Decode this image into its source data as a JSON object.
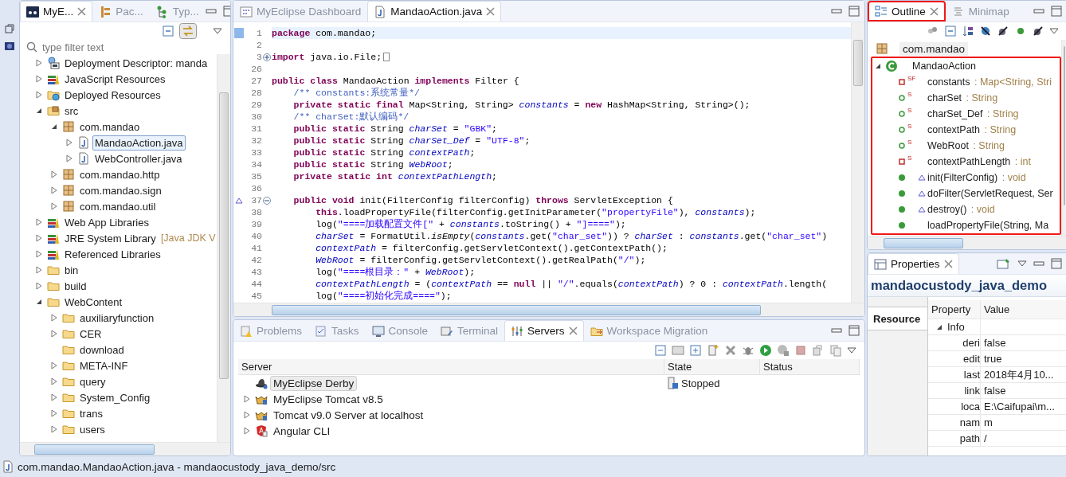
{
  "left_panel": {
    "tabs": [
      {
        "label": "MyE...",
        "selected": true,
        "kind": "explorer"
      },
      {
        "label": "Pac...",
        "selected": false,
        "kind": "packages"
      },
      {
        "label": "Typ...",
        "selected": false,
        "kind": "hierarchy"
      }
    ],
    "filter": {
      "placeholder": "type filter text"
    },
    "tree": [
      {
        "label": "Deployment Descriptor: manda",
        "kind": "descriptor",
        "expanded": false,
        "selected": false
      },
      {
        "label": "JavaScript Resources",
        "kind": "library",
        "expanded": false,
        "selected": false
      },
      {
        "label": "Deployed Resources",
        "kind": "deployed",
        "expanded": false,
        "selected": false
      },
      {
        "label": "src",
        "kind": "source-folder",
        "expanded": true,
        "selected": false,
        "children": [
          {
            "label": "com.mandao",
            "kind": "package",
            "expanded": true,
            "selected": false,
            "children": [
              {
                "label": "MandaoAction.java",
                "kind": "java",
                "expanded": false,
                "selected": true
              },
              {
                "label": "WebController.java",
                "kind": "java",
                "expanded": false,
                "selected": false
              }
            ]
          },
          {
            "label": "com.mandao.http",
            "kind": "package",
            "expanded": false,
            "selected": false
          },
          {
            "label": "com.mandao.sign",
            "kind": "package",
            "expanded": false,
            "selected": false
          },
          {
            "label": "com.mandao.util",
            "kind": "package",
            "expanded": false,
            "selected": false
          }
        ]
      },
      {
        "label": "Web App Libraries",
        "kind": "library",
        "expanded": false,
        "selected": false
      },
      {
        "label": "JRE System Library",
        "decoration": "[Java JDK V",
        "kind": "library",
        "expanded": false,
        "selected": false
      },
      {
        "label": "Referenced Libraries",
        "kind": "library",
        "expanded": false,
        "selected": false
      },
      {
        "label": "bin",
        "kind": "folder",
        "expanded": false,
        "selected": false
      },
      {
        "label": "build",
        "kind": "folder",
        "expanded": false,
        "selected": false
      },
      {
        "label": "WebContent",
        "kind": "folder",
        "expanded": true,
        "selected": false,
        "children": [
          {
            "label": "auxiliaryfunction",
            "kind": "folder",
            "expanded": false,
            "selected": false
          },
          {
            "label": "CER",
            "kind": "folder",
            "expanded": false,
            "selected": false
          },
          {
            "label": "download",
            "kind": "folder",
            "selected": false
          },
          {
            "label": "META-INF",
            "kind": "folder",
            "expanded": false,
            "selected": false
          },
          {
            "label": "query",
            "kind": "folder",
            "expanded": false,
            "selected": false
          },
          {
            "label": "System_Config",
            "kind": "folder",
            "expanded": false,
            "selected": false
          },
          {
            "label": "trans",
            "kind": "folder",
            "expanded": false,
            "selected": false
          },
          {
            "label": "users",
            "kind": "folder",
            "expanded": false,
            "selected": false
          }
        ]
      }
    ]
  },
  "editor": {
    "tabs": [
      {
        "label": "MyEclipse Dashboard",
        "selected": false,
        "kind": "dashboard"
      },
      {
        "label": "MandaoAction.java",
        "selected": true,
        "kind": "java"
      }
    ],
    "lines": [
      {
        "number": "1",
        "current": true,
        "tokens": [
          {
            "kind": "keyword",
            "text": "package"
          },
          {
            "kind": "plain",
            "text": " com.mandao;"
          }
        ]
      },
      {
        "number": "2",
        "current": false
      },
      {
        "number": "3",
        "current": false,
        "collapsed": true,
        "tokens": [
          {
            "kind": "keyword",
            "text": "import"
          },
          {
            "kind": "plain",
            "text": " java.io.File;"
          }
        ]
      },
      {
        "number": "26",
        "current": false
      },
      {
        "number": "27",
        "current": false,
        "tokens": [
          {
            "kind": "keyword",
            "text": "public class"
          },
          {
            "kind": "plain",
            "text": " MandaoAction "
          },
          {
            "kind": "keyword",
            "text": "implements"
          },
          {
            "kind": "plain",
            "text": " Filter {"
          }
        ]
      },
      {
        "number": "28",
        "current": false,
        "tokens": [
          {
            "kind": "comment",
            "text": "    /** constants:系统常量*/"
          }
        ]
      },
      {
        "number": "29",
        "current": false,
        "tokens": [
          {
            "kind": "keyword",
            "text": "    private static final"
          },
          {
            "kind": "plain",
            "text": " Map<String, String> "
          },
          {
            "kind": "field",
            "text": "constants"
          },
          {
            "kind": "plain",
            "text": " = "
          },
          {
            "kind": "keyword",
            "text": "new"
          },
          {
            "kind": "plain",
            "text": " HashMap<String, String>();"
          }
        ]
      },
      {
        "number": "30",
        "current": false,
        "tokens": [
          {
            "kind": "comment",
            "text": "    /** charSet:默认编码*/"
          }
        ]
      },
      {
        "number": "31",
        "current": false,
        "tokens": [
          {
            "kind": "keyword",
            "text": "    public static"
          },
          {
            "kind": "plain",
            "text": " String "
          },
          {
            "kind": "field",
            "text": "charSet"
          },
          {
            "kind": "plain",
            "text": " = "
          },
          {
            "kind": "string",
            "text": "\"GBK\""
          },
          {
            "kind": "plain",
            "text": ";"
          }
        ]
      },
      {
        "number": "32",
        "current": false,
        "tokens": [
          {
            "kind": "keyword",
            "text": "    public static"
          },
          {
            "kind": "plain",
            "text": " String "
          },
          {
            "kind": "field",
            "text": "charSet_Def"
          },
          {
            "kind": "plain",
            "text": " = "
          },
          {
            "kind": "string",
            "text": "\"UTF-8\""
          },
          {
            "kind": "plain",
            "text": ";"
          }
        ]
      },
      {
        "number": "33",
        "current": false,
        "tokens": [
          {
            "kind": "keyword",
            "text": "    public static"
          },
          {
            "kind": "plain",
            "text": " String "
          },
          {
            "kind": "field",
            "text": "contextPath"
          },
          {
            "kind": "plain",
            "text": ";"
          }
        ]
      },
      {
        "number": "34",
        "current": false,
        "tokens": [
          {
            "kind": "keyword",
            "text": "    public static"
          },
          {
            "kind": "plain",
            "text": " String "
          },
          {
            "kind": "field",
            "text": "WebRoot"
          },
          {
            "kind": "plain",
            "text": ";"
          }
        ]
      },
      {
        "number": "35",
        "current": false,
        "tokens": [
          {
            "kind": "keyword",
            "text": "    private static int"
          },
          {
            "kind": "field",
            "text": " contextPathLength"
          },
          {
            "kind": "plain",
            "text": ";"
          }
        ]
      },
      {
        "number": "36",
        "current": false
      },
      {
        "number": "37",
        "current": false,
        "collapsed": false,
        "override": true,
        "tokens": [
          {
            "kind": "keyword",
            "text": "    public void"
          },
          {
            "kind": "plain",
            "text": " init(FilterConfig filterConfig) "
          },
          {
            "kind": "keyword",
            "text": "throws"
          },
          {
            "kind": "plain",
            "text": " ServletException {"
          }
        ]
      },
      {
        "number": "38",
        "current": false,
        "tokens": [
          {
            "kind": "keyword",
            "text": "        this"
          },
          {
            "kind": "plain",
            "text": ".loadPropertyFile(filterConfig.getInitParameter("
          },
          {
            "kind": "string",
            "text": "\"propertyFile\""
          },
          {
            "kind": "plain",
            "text": "), "
          },
          {
            "kind": "field",
            "text": "constants"
          },
          {
            "kind": "plain",
            "text": ");"
          }
        ]
      },
      {
        "number": "39",
        "current": false,
        "tokens": [
          {
            "kind": "plain",
            "text": "        log("
          },
          {
            "kind": "string",
            "text": "\"====加载配置文件[\""
          },
          {
            "kind": "plain",
            "text": " + "
          },
          {
            "kind": "field",
            "text": "constants"
          },
          {
            "kind": "plain",
            "text": ".toString() + "
          },
          {
            "kind": "string",
            "text": "\"]====\""
          },
          {
            "kind": "plain",
            "text": ");"
          }
        ]
      },
      {
        "number": "40",
        "current": false,
        "tokens": [
          {
            "kind": "field",
            "text": "        charSet"
          },
          {
            "kind": "plain",
            "text": " = FormatUtil."
          },
          {
            "kind": "static",
            "text": "isEmpty"
          },
          {
            "kind": "plain",
            "text": "("
          },
          {
            "kind": "field",
            "text": "constants"
          },
          {
            "kind": "plain",
            "text": ".get("
          },
          {
            "kind": "string",
            "text": "\"char_set\""
          },
          {
            "kind": "plain",
            "text": ")) ? "
          },
          {
            "kind": "field",
            "text": "charSet"
          },
          {
            "kind": "plain",
            "text": " : "
          },
          {
            "kind": "field",
            "text": "constants"
          },
          {
            "kind": "plain",
            "text": ".get("
          },
          {
            "kind": "string",
            "text": "\"char_set\""
          },
          {
            "kind": "plain",
            "text": ")"
          }
        ]
      },
      {
        "number": "41",
        "current": false,
        "tokens": [
          {
            "kind": "field",
            "text": "        contextPath"
          },
          {
            "kind": "plain",
            "text": " = filterConfig.getServletContext().getContextPath();"
          }
        ]
      },
      {
        "number": "42",
        "current": false,
        "tokens": [
          {
            "kind": "field",
            "text": "        WebRoot"
          },
          {
            "kind": "plain",
            "text": " = filterConfig.getServletContext().getRealPath("
          },
          {
            "kind": "string",
            "text": "\"/\""
          },
          {
            "kind": "plain",
            "text": ");"
          }
        ]
      },
      {
        "number": "43",
        "current": false,
        "tokens": [
          {
            "kind": "plain",
            "text": "        log("
          },
          {
            "kind": "string",
            "text": "\"====根目录：\""
          },
          {
            "kind": "plain",
            "text": " + "
          },
          {
            "kind": "field",
            "text": "WebRoot"
          },
          {
            "kind": "plain",
            "text": ");"
          }
        ]
      },
      {
        "number": "44",
        "current": false,
        "tokens": [
          {
            "kind": "field",
            "text": "        contextPathLength"
          },
          {
            "kind": "plain",
            "text": " = ("
          },
          {
            "kind": "field",
            "text": "contextPath"
          },
          {
            "kind": "plain",
            "text": " == "
          },
          {
            "kind": "keyword",
            "text": "null"
          },
          {
            "kind": "plain",
            "text": " || "
          },
          {
            "kind": "string",
            "text": "\"/\""
          },
          {
            "kind": "plain",
            "text": ".equals("
          },
          {
            "kind": "field",
            "text": "contextPath"
          },
          {
            "kind": "plain",
            "text": ") ? 0 : "
          },
          {
            "kind": "field",
            "text": "contextPath"
          },
          {
            "kind": "plain",
            "text": ".length("
          }
        ]
      },
      {
        "number": "45",
        "current": false,
        "tokens": [
          {
            "kind": "plain",
            "text": "        log("
          },
          {
            "kind": "string",
            "text": "\"====初始化完成====\""
          },
          {
            "kind": "plain",
            "text": ");"
          }
        ]
      }
    ]
  },
  "outline": {
    "tabs": [
      {
        "label": "Outline",
        "selected": true,
        "annotated": true,
        "kind": "outline"
      },
      {
        "label": "Minimap",
        "selected": false,
        "annotated": false,
        "kind": "minimap"
      }
    ],
    "package": "com.mandao",
    "class": {
      "name": "MandaoAction",
      "expanded": true,
      "annotated": true,
      "members": [
        {
          "name": "constants",
          "type": ": Map<String, Stri",
          "kind": "field",
          "private": true,
          "modifiers": "SF",
          "override": false
        },
        {
          "name": "charSet",
          "type": ": String",
          "kind": "field",
          "private": false,
          "modifiers": "S",
          "override": false
        },
        {
          "name": "charSet_Def",
          "type": ": String",
          "kind": "field",
          "private": false,
          "modifiers": "S",
          "override": false
        },
        {
          "name": "contextPath",
          "type": ": String",
          "kind": "field",
          "private": false,
          "modifiers": "S",
          "override": false
        },
        {
          "name": "WebRoot",
          "type": ": String",
          "kind": "field",
          "private": false,
          "modifiers": "S",
          "override": false
        },
        {
          "name": "contextPathLength",
          "type": ": int",
          "kind": "field",
          "private": true,
          "modifiers": "S",
          "override": false
        },
        {
          "name": "init(FilterConfig)",
          "type": ": void",
          "kind": "method",
          "override": true
        },
        {
          "name": "doFilter(ServletRequest, Ser",
          "kind": "method",
          "override": true
        },
        {
          "name": "destroy()",
          "type": ": void",
          "kind": "method",
          "override": true
        },
        {
          "name": "loadPropertyFile(String, Ma",
          "kind": "method",
          "override": false
        }
      ]
    }
  },
  "properties": {
    "tab": {
      "label": "Properties"
    },
    "title": "mandaocustody_java_demo",
    "sections": [
      {
        "label": "Resource",
        "selected": true
      }
    ],
    "columns": [
      "Property",
      "Value"
    ],
    "groups": [
      {
        "label": "Info",
        "expanded": true,
        "rows": [
          {
            "property": "deri",
            "value": "false"
          },
          {
            "property": "edit",
            "value": "true"
          },
          {
            "property": "last",
            "value": "2018年4月10..."
          },
          {
            "property": "link",
            "value": "false"
          },
          {
            "property": "loca",
            "value": "E:\\Caifupai\\m..."
          },
          {
            "property": "nam",
            "value": "m"
          },
          {
            "property": "path",
            "value": "/"
          }
        ]
      }
    ]
  },
  "servers": {
    "tabs": [
      {
        "label": "Problems",
        "selected": false,
        "kind": "problems"
      },
      {
        "label": "Tasks",
        "selected": false,
        "kind": "tasks"
      },
      {
        "label": "Console",
        "selected": false,
        "kind": "console"
      },
      {
        "label": "Terminal",
        "selected": false,
        "kind": "terminal"
      },
      {
        "label": "Servers",
        "selected": true,
        "kind": "servers"
      },
      {
        "label": "Workspace Migration",
        "selected": false,
        "kind": "migration"
      }
    ],
    "columns": [
      "Server",
      "State",
      "Status"
    ],
    "rows": [
      {
        "name": "MyEclipse Derby",
        "kind": "derby",
        "selected": true,
        "state": "Stopped"
      },
      {
        "name": "MyEclipse Tomcat v8.5",
        "kind": "tomcat",
        "expanded": false,
        "selected": false
      },
      {
        "name": "Tomcat v9.0 Server at localhost",
        "kind": "tomcat",
        "expanded": false,
        "selected": false
      },
      {
        "name": "Angular CLI",
        "kind": "angular",
        "expanded": false,
        "selected": false
      }
    ]
  },
  "status_bar": {
    "text": "com.mandao.MandaoAction.java - mandaocustody_java_demo/src"
  }
}
